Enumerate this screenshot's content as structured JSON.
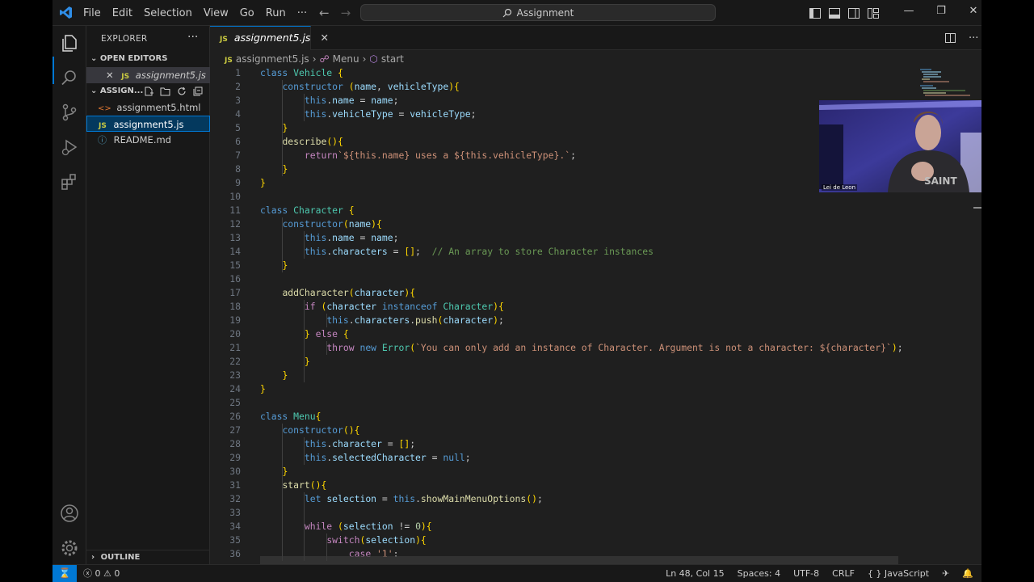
{
  "titlebar": {
    "menu": [
      "File",
      "Edit",
      "Selection",
      "View",
      "Go",
      "Run",
      "···"
    ],
    "search_text": "Assignment"
  },
  "sidebar": {
    "title": "EXPLORER",
    "open_editors_label": "OPEN EDITORS",
    "open_editor_file": "assignment5.js",
    "folder_label": "ASSIGN...",
    "files": [
      "assignment5.html",
      "assignment5.js",
      "README.md"
    ],
    "outline_label": "OUTLINE"
  },
  "editor": {
    "tab_label": "assignment5.js",
    "breadcrumb": [
      "assignment5.js",
      "Menu",
      "start"
    ]
  },
  "webcam": {
    "name": "Lei de Leon"
  },
  "code": {
    "lines": [
      "class Vehicle {",
      "    constructor (name, vehicleType){",
      "        this.name = name;",
      "        this.vehicleType = vehicleType;",
      "    }",
      "    describe(){",
      "        return`${this.name} uses a ${this.vehicleType}.`;",
      "    }",
      "}",
      "",
      "class Character {",
      "    constructor(name){",
      "        this.name = name;",
      "        this.characters = [];  // An array to store Character instances",
      "    }",
      "",
      "    addCharacter(character){",
      "        if (character instanceof Character){",
      "            this.characters.push(character);",
      "        } else {",
      "            throw new Error(`You can only add an instance of Character. Argument is not a character: ${character}`);",
      "        }",
      "    }",
      "}",
      "",
      "class Menu{",
      "    constructor(){",
      "        this.character = [];",
      "        this.selectedCharacter = null;",
      "    }",
      "    start(){",
      "        let selection = this.showMainMenuOptions();",
      "",
      "        while (selection != 0){",
      "            switch(selection){",
      "                case '1':"
    ]
  },
  "status": {
    "problems": "ⓧ 0 ⚠ 0",
    "position": "Ln 48, Col 15",
    "spaces": "Spaces: 4",
    "encoding": "UTF-8",
    "eol": "CRLF",
    "language": "{ } JavaScript"
  },
  "colors": {
    "accent": "#0078d4",
    "background": "#1f1f1f",
    "sidebar": "#181818"
  }
}
